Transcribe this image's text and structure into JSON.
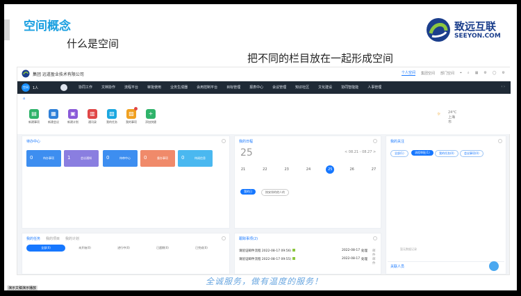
{
  "slide": {
    "title": "空间概念",
    "line1": "什么是空间",
    "line2": "把不同的栏目放在一起形成空间",
    "slogan": "全诚服务，做有温度的服务！",
    "ppt_badge": "演示文稿演示播放",
    "logo_cn": "致远互联",
    "logo_en": "SEEYON.COM"
  },
  "app": {
    "company": "集团  远道盈业技术有限公司",
    "top_tabs": [
      "个人空间",
      "集团空间",
      "部门空间"
    ],
    "user_name": "1人",
    "user_avatar": "空间",
    "nav_items": [
      "协同工作",
      "文档协作",
      "流程平台",
      "审批使用",
      "业务生成器",
      "会用控制平台",
      "目标管理",
      "报表中心",
      "会议管理",
      "知识社区",
      "文化建设",
      "协同智能能",
      "人事管理"
    ],
    "shortcuts": [
      {
        "label": "新建事项",
        "color": "#2fb36a",
        "glyph": "▤"
      },
      {
        "label": "新建会议",
        "color": "#2f80d8",
        "glyph": "▦"
      },
      {
        "label": "新建计划",
        "color": "#8a5ad8",
        "glyph": "▣"
      },
      {
        "label": "通讯录",
        "color": "#e04646",
        "glyph": "▥"
      },
      {
        "label": "我的任务",
        "color": "#1ba7e0",
        "glyph": "▧"
      },
      {
        "label": "我的事项",
        "color": "#f0a020",
        "glyph": "▨"
      },
      {
        "label": "添加快捷",
        "color": "#2fb36a",
        "glyph": "+"
      }
    ],
    "weather": {
      "temp": "24°C",
      "city": "上海市"
    },
    "todo_center": {
      "title": "待办中心",
      "tiles": [
        {
          "num": "0",
          "label": "待办事项",
          "color": "#3d8ef0"
        },
        {
          "num": "1",
          "label": "会议通知",
          "color": "#8a7ee0"
        },
        {
          "num": "0",
          "label": "待审中心",
          "color": "#3d8ef0"
        },
        {
          "num": "0",
          "label": "督办事项",
          "color": "#f08a6a"
        },
        {
          "num": "0",
          "label": "待阅信息",
          "color": "#4ab8f0"
        }
      ]
    },
    "calendar": {
      "title": "我的日程",
      "date": "25",
      "range": "< 08.21 - 08.27 >",
      "days": [
        "21",
        "22",
        "23",
        "24",
        "25",
        "26",
        "27"
      ],
      "today": "25",
      "btn_primary": "我的日",
      "btn_secondary": "按安排的他人的"
    },
    "my_apps": {
      "title": "我的关注",
      "pills": [
        "全部(1)",
        "流程审批(1)",
        "我的任务(0)",
        "会议事项(0)"
      ],
      "empty_note": "暂无数据记录"
    },
    "my_tasks": {
      "tabs": [
        "我的任务",
        "我的项目",
        "我的计划"
      ],
      "filters": [
        "全部(0)",
        "未开始(0)",
        "进行中(0)",
        "已超期(0)",
        "已完成(0)"
      ]
    },
    "pending": {
      "title": "跟踪事项(2)",
      "rows": [
        {
          "title": "请验证邮件流程 2022-08-17 09:56)",
          "date": "2022-08-17",
          "status": "处理",
          "extra": "邮件"
        },
        {
          "title": "请验证邮件流程 2022-08-17 09:55)",
          "date": "2022-08-17",
          "status": "处理",
          "extra": "邮件"
        }
      ]
    },
    "contacts": {
      "title": "关联人员"
    }
  }
}
